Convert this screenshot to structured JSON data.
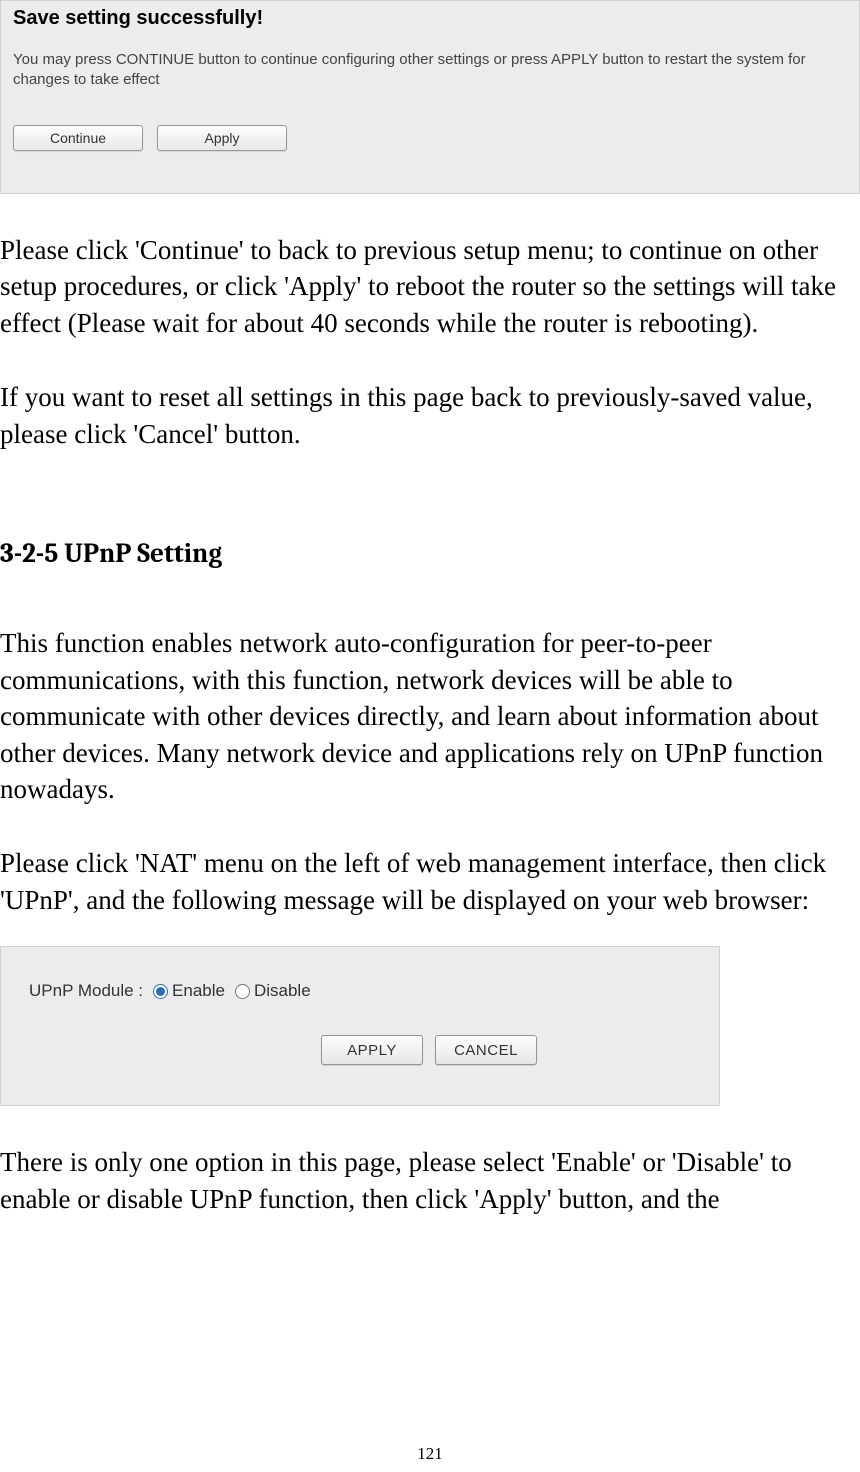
{
  "panel1": {
    "title": "Save setting successfully!",
    "desc": "You may press CONTINUE button to continue configuring other settings or press APPLY button to restart the system for changes to take effect",
    "continue_label": "Continue",
    "apply_label": "Apply"
  },
  "body": {
    "p1": "Please click 'Continue' to back to previous setup menu; to continue on other setup procedures, or click 'Apply' to reboot the router so the settings will take effect (Please wait for about 40 seconds while the router is rebooting).",
    "p2": "If you want to reset all settings in this page back to previously-saved value, please click 'Cancel' button.",
    "heading": "3-2-5 UPnP Setting",
    "p3": "This function enables network auto-configuration for peer-to-peer communications, with this function, network devices will be able to communicate with other devices directly, and learn about information about other devices. Many network device and applications rely on UPnP function nowadays.",
    "p4": "Please click 'NAT' menu on the left of web management interface, then click 'UPnP', and the following message will be displayed on your web browser:",
    "p5": "There is only one option in this page, please select 'Enable' or 'Disable' to enable or disable UPnP function, then click 'Apply' button, and the"
  },
  "panel2": {
    "label": "UPnP Module :",
    "enable": "Enable",
    "disable": "Disable",
    "apply_label": "APPLY",
    "cancel_label": "CANCEL"
  },
  "page_number": "121"
}
